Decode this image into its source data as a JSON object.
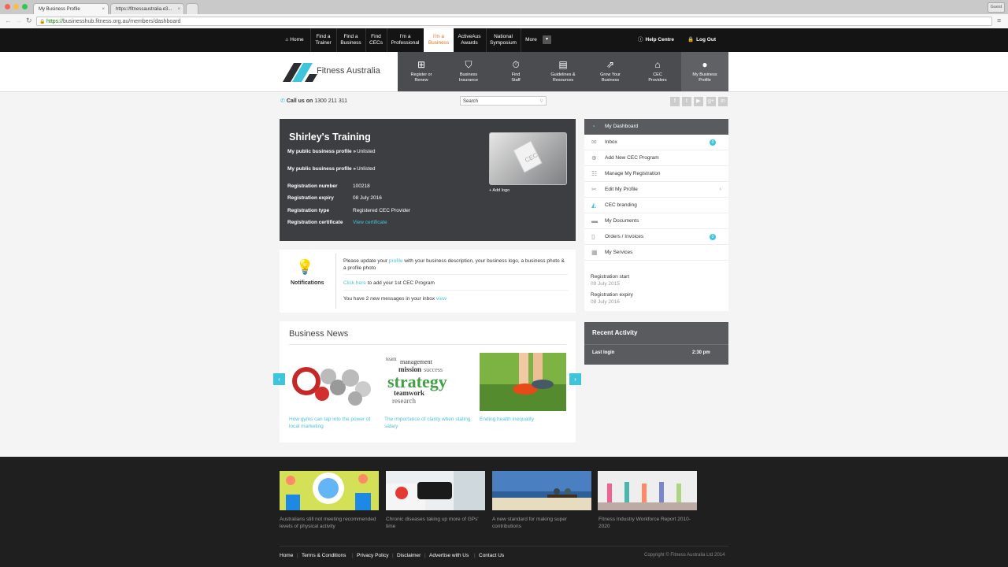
{
  "browser": {
    "tabs": [
      {
        "label": "My Business Profile"
      },
      {
        "label": "https://fitnessaustralia.e3..."
      }
    ],
    "guest": "Guest",
    "url_scheme": "https://",
    "url_rest": "businesshub.fitness.org.au/members/dashboard"
  },
  "topnav": {
    "items": [
      "Home",
      "Find a\nTrainer",
      "Find a\nBusiness",
      "Find\nCECs",
      "I'm a\nProfessional",
      "I'm a\nBusiness",
      "ActiveAus\nAwards",
      "National\nSymposium",
      "More"
    ],
    "help": "Help Centre",
    "logout": "Log Out"
  },
  "header": {
    "logo_text": "Fitness Australia",
    "tiles": [
      "Register or\nRenew",
      "Business\nInsurance",
      "Find\nStaff",
      "Guidelines &\nResources",
      "Grow Your\nBusiness",
      "CEC\nProviders",
      "My Business\nProfile"
    ]
  },
  "subbar": {
    "call_label": "Call us on",
    "phone": "1300 211 311",
    "search_value": "Search"
  },
  "profile": {
    "name": "Shirley's Training",
    "public_label": "My public business profile »",
    "public_value": "Unlisted",
    "public_label2": "My public business profile »",
    "public_value2": "Unlisted",
    "reg_number_label": "Registration number",
    "reg_number": "100218",
    "reg_expiry_label": "Registration expiry",
    "reg_expiry": "08 July 2016",
    "reg_type_label": "Registration type",
    "reg_type": "Registered CEC Provider",
    "reg_cert_label": "Registration certificate",
    "reg_cert_link": "View certificate",
    "logo_placeholder": "CEC",
    "add_logo": "+ Add logo"
  },
  "notifications": {
    "title": "Notifications",
    "msg1_a": "Please update your ",
    "msg1_link": "profile",
    "msg1_b": " with your business description, your business logo, a business photo & a profile photo",
    "msg2_link": "Click here",
    "msg2_b": " to add your 1st CEC Program",
    "msg3_a": "You have 2 new messages in your inbox ",
    "msg3_link": "view"
  },
  "news": {
    "title": "Business News",
    "items": [
      {
        "caption": "How gyms can tap into the power of local marketing"
      },
      {
        "caption": "The importance of clarity when stating salary"
      },
      {
        "caption": "Ending health inequality"
      }
    ],
    "strategy_words": [
      "strategy",
      "management",
      "teamwork",
      "mission",
      "research",
      "success",
      "team"
    ]
  },
  "sidebar": {
    "items": [
      {
        "label": "My Dashboard"
      },
      {
        "label": "Inbox",
        "badge": "0"
      },
      {
        "label": "Add New CEC Program"
      },
      {
        "label": "Manage My Registration"
      },
      {
        "label": "Edit My Profile"
      },
      {
        "label": "CEC branding"
      },
      {
        "label": "My Documents"
      },
      {
        "label": "Orders / Invoices",
        "badge": "0"
      },
      {
        "label": "My Services"
      }
    ],
    "reg_start_label": "Registration start",
    "reg_start": "09 July 2015",
    "reg_expiry_label": "Registration expiry",
    "reg_expiry": "08 July 2016"
  },
  "recent": {
    "title": "Recent Activity",
    "last_login_label": "Last login",
    "last_login_time": "2:30 pm"
  },
  "footer": {
    "articles": [
      {
        "caption": "Australians still not meeting recommended levels of physical activity"
      },
      {
        "caption": "Chronic diseases taking up more of GPs' time"
      },
      {
        "caption": "A new standard for making super contributions"
      },
      {
        "caption": "Fitness Industry Workforce Report 2010-2020"
      }
    ],
    "links": [
      "Home",
      "Terms & Conditions",
      "Privacy Policy",
      "Disclaimer",
      "Advertise with Us",
      "Contact Us"
    ],
    "copyright": "Copyright © Fitness Australia Ltd 2014"
  },
  "colors": {
    "accent": "#3ec5dc",
    "orange": "#e8701a",
    "dark_panel": "#3c3e41"
  }
}
